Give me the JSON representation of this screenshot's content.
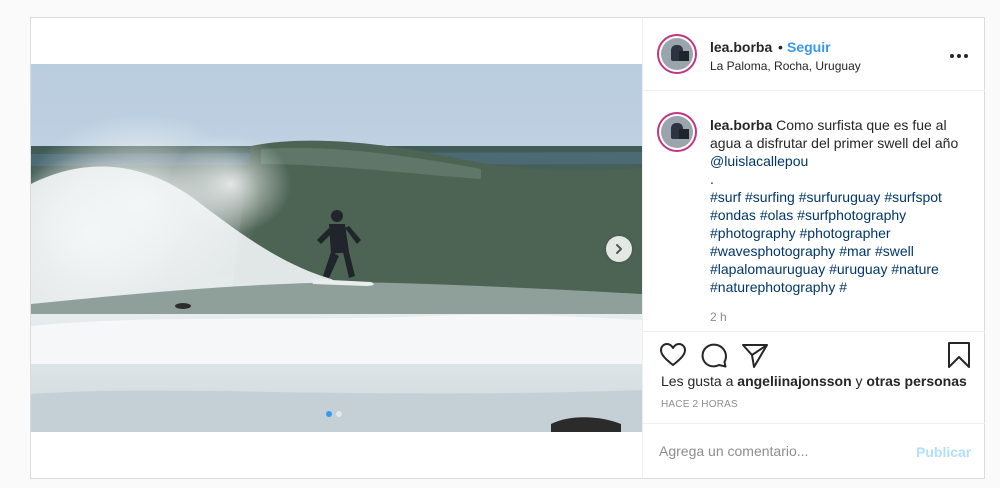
{
  "post": {
    "username": "lea.borba",
    "separator": "•",
    "follow_label": "Seguir",
    "location": "La Paloma, Rocha, Uruguay",
    "caption": {
      "username": "lea.borba",
      "text": "Como surfista que es fue al agua a disfrutar del primer swell del año",
      "mention": "@luislacallepou",
      "dot": ".",
      "hashtags": "#surf #surfing #surfuruguay #surfspot #ondas #olas #surfphotography #photography #photographer #wavesphotography #mar #swell #lapalomauruguay #uruguay #nature #naturephotography #"
    },
    "comment_time": "2 h",
    "likes": {
      "prefix": "Les gusta a",
      "user": "angeliinajonsson",
      "conj": "y",
      "others": "otras personas"
    },
    "posted_ago": "HACE 2 HORAS",
    "comment_input": {
      "placeholder": "Agrega un comentario...",
      "value": ""
    },
    "publish_label": "Publicar",
    "carousel": {
      "slides": 2,
      "current": 1
    }
  },
  "icons": {
    "like": "heart-icon",
    "comment": "comment-bubble-icon",
    "share": "paper-plane-icon",
    "save": "bookmark-icon",
    "more": "more-options-icon",
    "next": "chevron-right-icon"
  },
  "colors": {
    "link": "#3897f0",
    "hashtag": "#00376b",
    "publish_disabled": "#b2dffc",
    "muted": "#8e8e8e"
  }
}
